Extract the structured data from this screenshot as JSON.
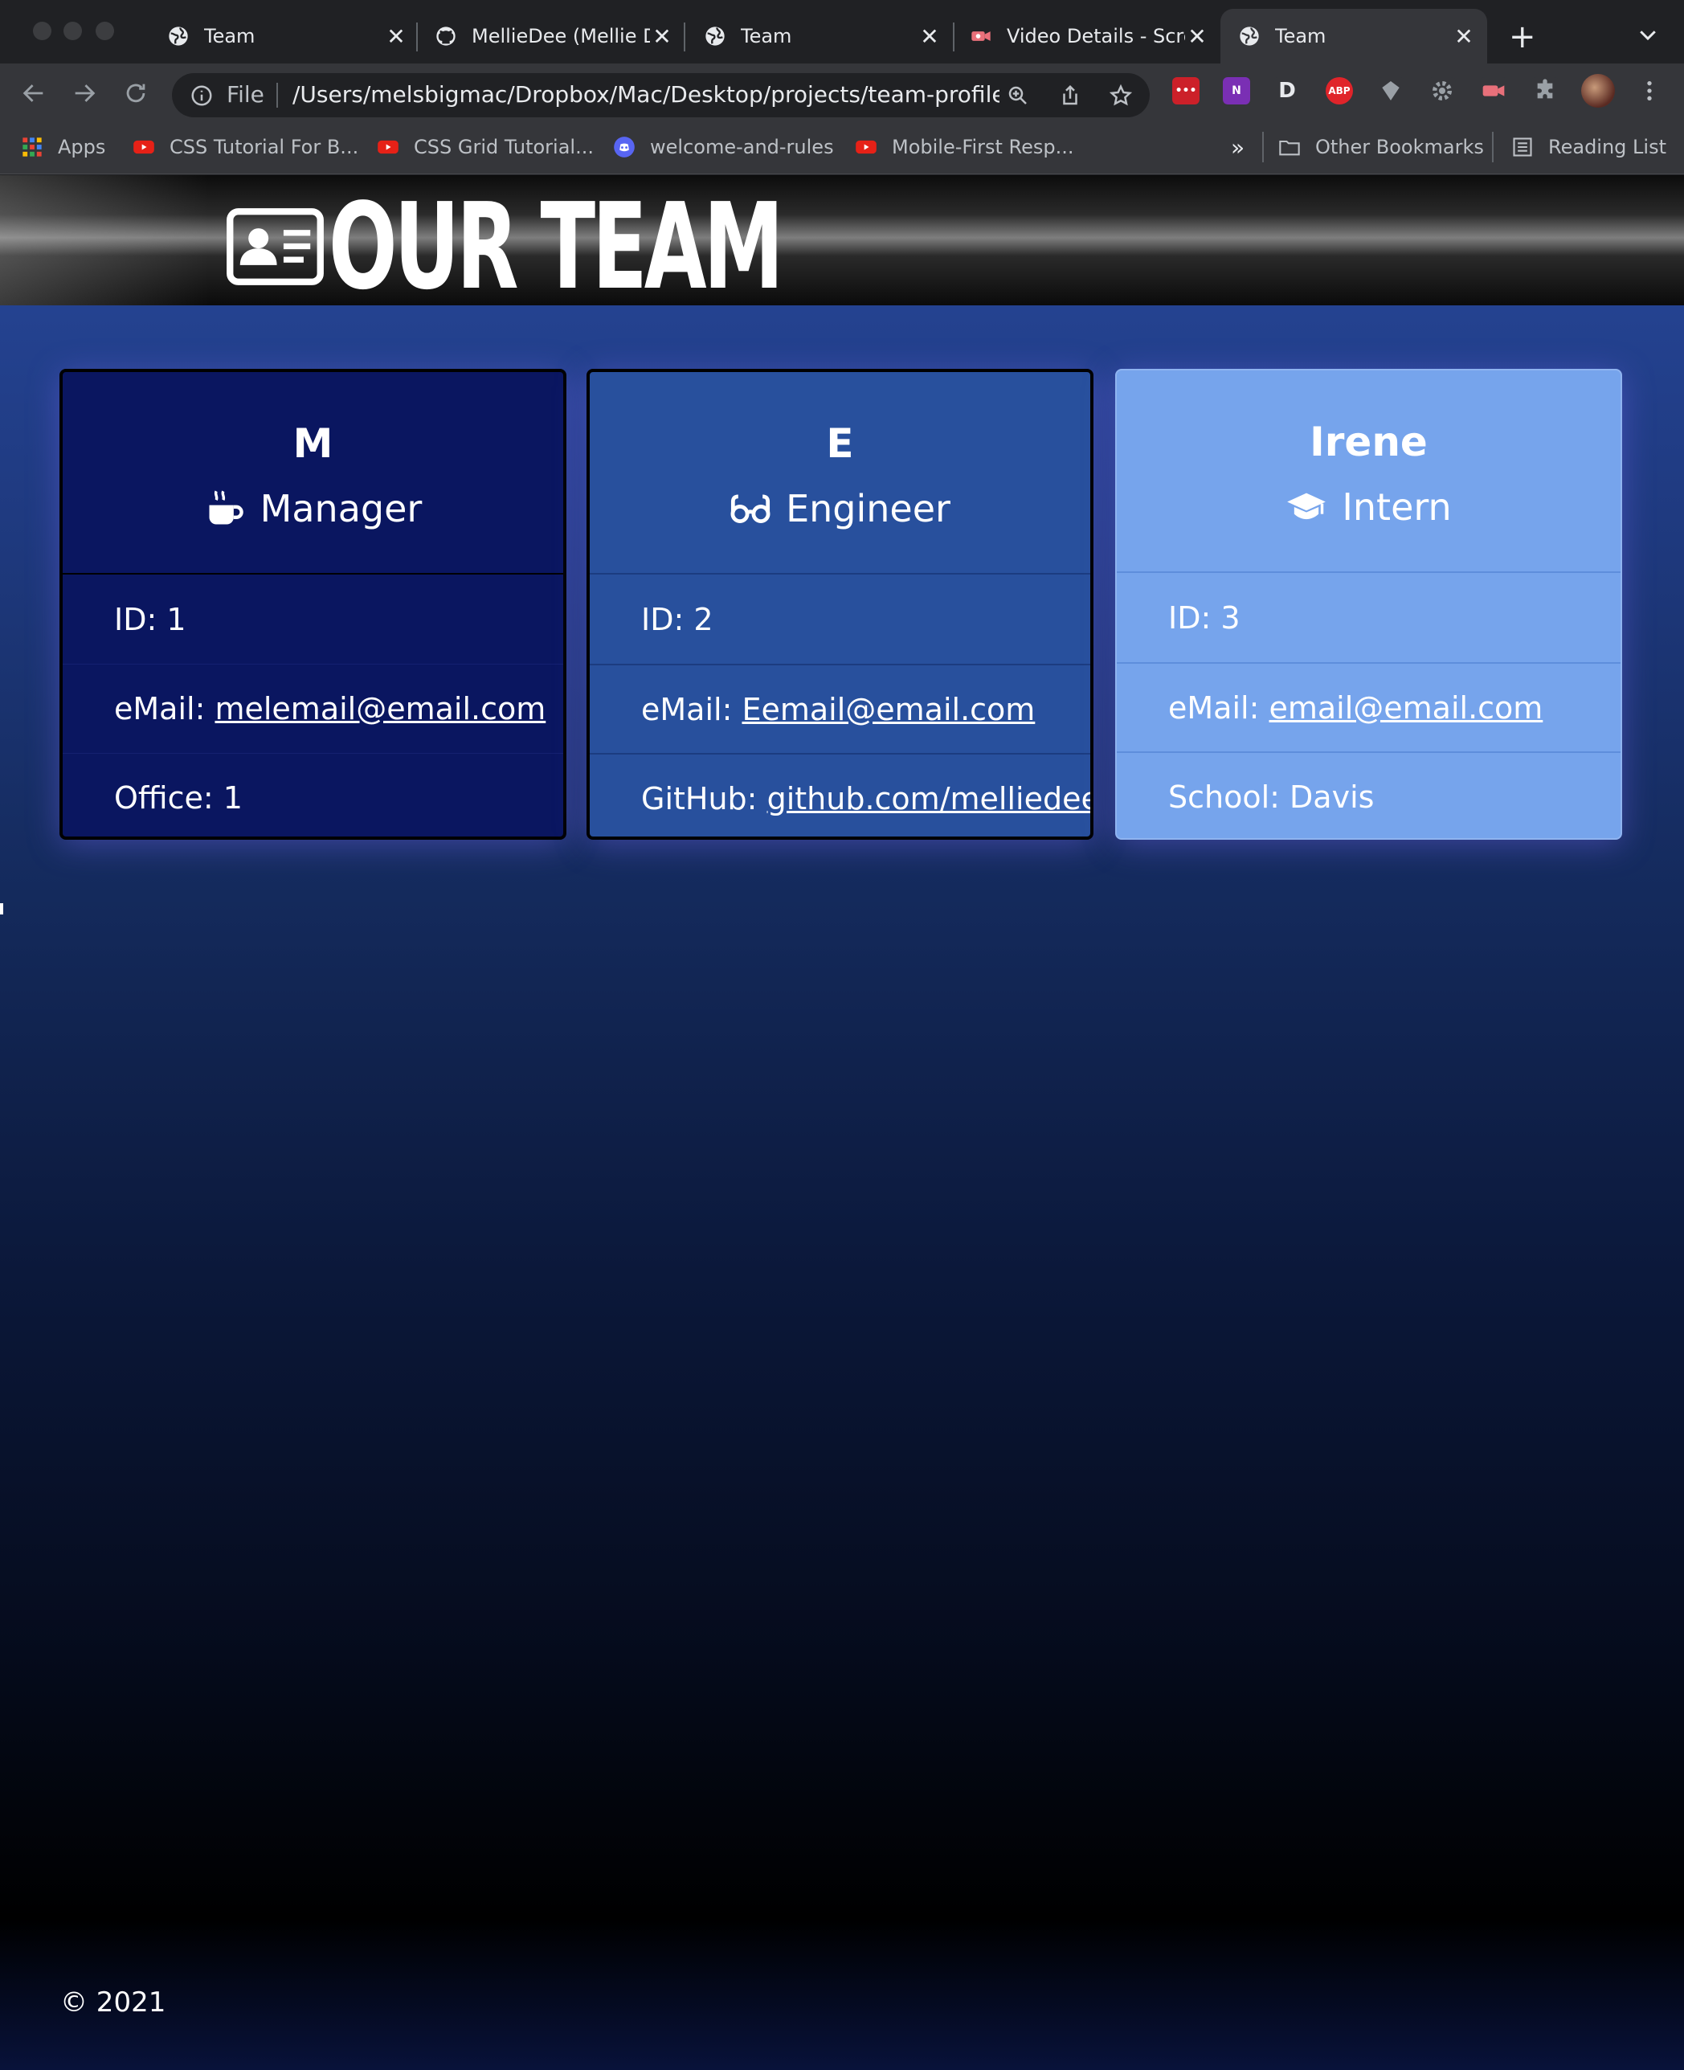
{
  "browser": {
    "tabs": [
      {
        "title": "Team",
        "icon": "globe-icon"
      },
      {
        "title": "MellieDee (Mellie Dee)",
        "icon": "github-icon"
      },
      {
        "title": "Team",
        "icon": "globe-icon"
      },
      {
        "title": "Video Details - Screencastify",
        "icon": "screencastify-icon"
      },
      {
        "title": "Team",
        "icon": "globe-icon",
        "active": true
      }
    ],
    "address": {
      "scheme_label": "File",
      "url": "/Users/melsbigmac/Dropbox/Mac/Desktop/projects/team-profile..."
    },
    "bookmarks": [
      {
        "label": "Apps",
        "icon": "apps-grid-icon"
      },
      {
        "label": "CSS Tutorial For B...",
        "icon": "youtube-icon"
      },
      {
        "label": "CSS Grid Tutorial...",
        "icon": "youtube-icon"
      },
      {
        "label": "welcome-and-rules",
        "icon": "discord-icon"
      },
      {
        "label": "Mobile-First Resp...",
        "icon": "youtube-icon"
      }
    ],
    "bookmarks_overflow": "»",
    "other_bookmarks": "Other Bookmarks",
    "reading_list": "Reading List",
    "extensions": [
      {
        "name": "lastpass-icon",
        "text": "•••",
        "color": "#cc2029"
      },
      {
        "name": "onenote-icon",
        "text": "N",
        "color": "#7a2fb4"
      },
      {
        "name": "dashlane-icon",
        "text": "D",
        "color": "#3c3d40"
      },
      {
        "name": "adblock-plus-icon",
        "text": "ABP",
        "color": "#e0242a"
      },
      {
        "name": "gem-icon",
        "text": "",
        "color": "#6c6e72"
      },
      {
        "name": "settings-ext-icon",
        "text": "",
        "color": "#6c6e72"
      },
      {
        "name": "screencastify-icon",
        "text": "",
        "color": "#e8707a"
      },
      {
        "name": "puzzle-icon",
        "text": "",
        "color": "#6c6e72"
      }
    ]
  },
  "page": {
    "title": "OUR TEAM",
    "title_icon": "id-card-icon",
    "footer": "© 2021"
  },
  "team": [
    {
      "name": "M",
      "role": "Manager",
      "role_icon": "coffee-mug-icon",
      "id_text": "ID: 1",
      "email_label": "eMail: ",
      "email": "melemail@email.com",
      "extra_label": "Office: 1",
      "extra_link": ""
    },
    {
      "name": "E",
      "role": "Engineer",
      "role_icon": "glasses-icon",
      "id_text": "ID: 2",
      "email_label": "eMail: ",
      "email": "Eemail@email.com",
      "extra_label": "GitHub: ",
      "extra_link": "github.com/melliedee"
    },
    {
      "name": "Irene",
      "role": "Intern",
      "role_icon": "graduation-cap-icon",
      "id_text": "ID: 3",
      "email_label": "eMail: ",
      "email": "email@email.com",
      "extra_label": "School: Davis",
      "extra_link": ""
    }
  ]
}
